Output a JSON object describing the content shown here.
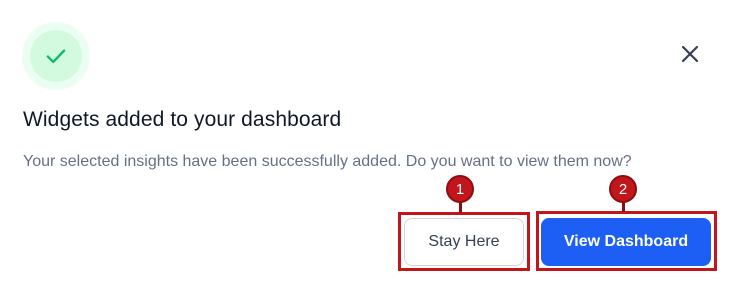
{
  "dialog": {
    "title": "Widgets added to your dashboard",
    "message": "Your selected insights have been successfully added. Do you want to view them now?",
    "success_icon": "check-icon",
    "close_icon": "close-icon",
    "buttons": {
      "stay_label": "Stay Here",
      "view_label": "View Dashboard"
    }
  },
  "annotations": {
    "step1": "1",
    "step2": "2"
  },
  "colors": {
    "primary": "#1d5ff5",
    "success": "#12b76a",
    "annotation": "#c0161c"
  }
}
